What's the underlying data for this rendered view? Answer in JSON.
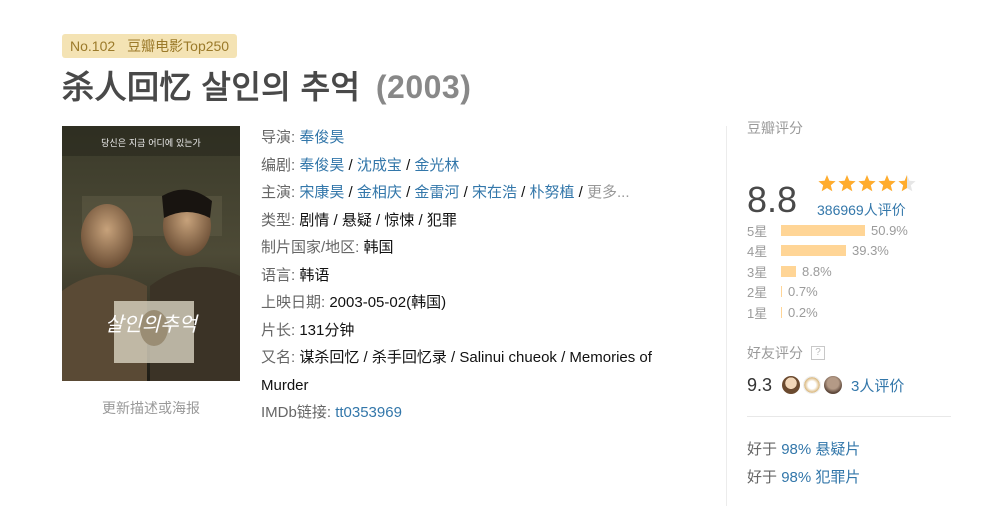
{
  "badge": {
    "rank": "No.102",
    "list": "豆瓣电影Top250"
  },
  "title": {
    "name": "杀人回忆 살인의 추억",
    "year": "(2003)"
  },
  "poster": {
    "overlay_text_top": "당신은 지금 어디에 있는가",
    "overlay_title": "살인의추억",
    "update_link": "更新描述或海报"
  },
  "info": {
    "director_label": "导演",
    "director": "奉俊昊",
    "writer_label": "编剧",
    "writers": [
      "奉俊昊",
      "沈成宝",
      "金光林"
    ],
    "cast_label": "主演",
    "cast": [
      "宋康昊",
      "金相庆",
      "金雷河",
      "宋在浩",
      "朴努植"
    ],
    "cast_more": "更多...",
    "genre_label": "类型:",
    "genres": "剧情 / 悬疑 / 惊悚 / 犯罪",
    "country_label": "制片国家/地区:",
    "country": "韩国",
    "language_label": "语言:",
    "language": "韩语",
    "release_label": "上映日期:",
    "release": "2003-05-02(韩国)",
    "runtime_label": "片长:",
    "runtime": "131分钟",
    "aka_label": "又名:",
    "aka": "谋杀回忆 / 杀手回忆录 / Salinui chueok / Memories of Murder",
    "imdb_label": "IMDb链接:",
    "imdb": "tt0353969"
  },
  "rating": {
    "header": "豆瓣评分",
    "score": "8.8",
    "stars": 4.5,
    "votes": "386969人评价",
    "distribution": [
      {
        "label": "5星",
        "percent": 50.9,
        "text": "50.9%"
      },
      {
        "label": "4星",
        "percent": 39.3,
        "text": "39.3%"
      },
      {
        "label": "3星",
        "percent": 8.8,
        "text": "8.8%"
      },
      {
        "label": "2星",
        "percent": 0.7,
        "text": "0.7%"
      },
      {
        "label": "1星",
        "percent": 0.2,
        "text": "0.2%"
      }
    ],
    "star_color": "#ffac2d",
    "bar_color": "#ffd596"
  },
  "friends": {
    "header": "好友评分",
    "help_icon": "?",
    "score": "9.3",
    "votes": "3人评价"
  },
  "better_than": [
    {
      "prefix": "好于",
      "percent": "98%",
      "genre": "悬疑片"
    },
    {
      "prefix": "好于",
      "percent": "98%",
      "genre": "犯罪片"
    }
  ],
  "colors": {
    "link": "#3377aa",
    "title": "#494949",
    "badge_bg": "#f4e3b4",
    "badge_text": "#9b7a2a"
  }
}
